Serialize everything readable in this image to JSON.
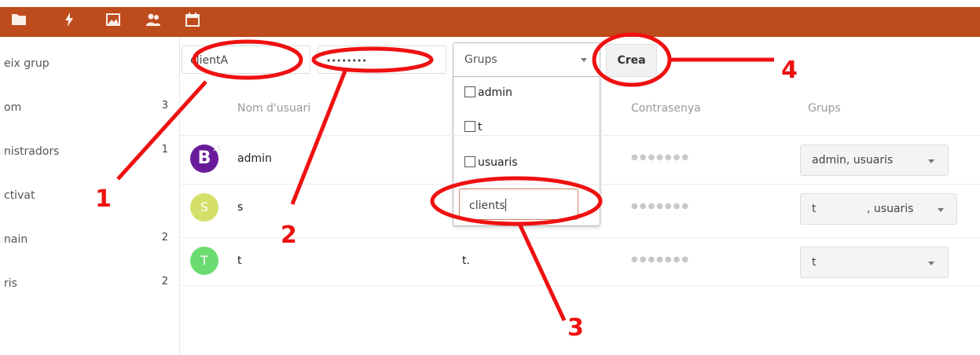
{
  "colors": {
    "header": "#bd4b1c",
    "annotation": "#ef1010",
    "avatar_b": "#6a1b9a",
    "avatar_s": "#d4e06a",
    "avatar_t": "#6bdc70"
  },
  "topbar": {
    "icons": [
      "folder-icon",
      "activity-icon",
      "gallery-icon",
      "contacts-icon",
      "calendar-icon"
    ]
  },
  "sidebar": {
    "items": [
      {
        "label": "eix grup",
        "count": ""
      },
      {
        "label": "om",
        "count": "3"
      },
      {
        "label": "nistradors",
        "count": "1"
      },
      {
        "label": "ctivat",
        "count": ""
      },
      {
        "label": "nain",
        "count": "2"
      },
      {
        "label": "ris",
        "count": "2"
      }
    ]
  },
  "form": {
    "username_value": "clientA",
    "password_value": "••••••••",
    "groups_label": "Grups",
    "create_label": "Crea",
    "dropdown": {
      "options": [
        {
          "label": "admin",
          "checked": false
        },
        {
          "label": "t",
          "checked": false
        },
        {
          "label": "usuaris",
          "checked": false
        }
      ],
      "new_group_value": "clients"
    }
  },
  "table": {
    "headers": {
      "username": "Nom d'usuari",
      "password": "Contrasenya",
      "groups": "Grups"
    },
    "rows": [
      {
        "avatar": "B",
        "avatar_badge": "10",
        "username": "admin",
        "display_name": "",
        "password": "●●●●●●●",
        "groups": "admin, usuaris"
      },
      {
        "avatar": "S",
        "avatar_badge": "",
        "username": "s",
        "display_name": "",
        "password": "●●●●●●●",
        "groups_first": "t",
        "groups": ", usuaris"
      },
      {
        "avatar": "T",
        "avatar_badge": "",
        "username": "t",
        "display_name": "t.",
        "password": "●●●●●●●",
        "groups": "t"
      }
    ]
  },
  "annotations": {
    "n1": "1",
    "n2": "2",
    "n3": "3",
    "n4": "4"
  }
}
